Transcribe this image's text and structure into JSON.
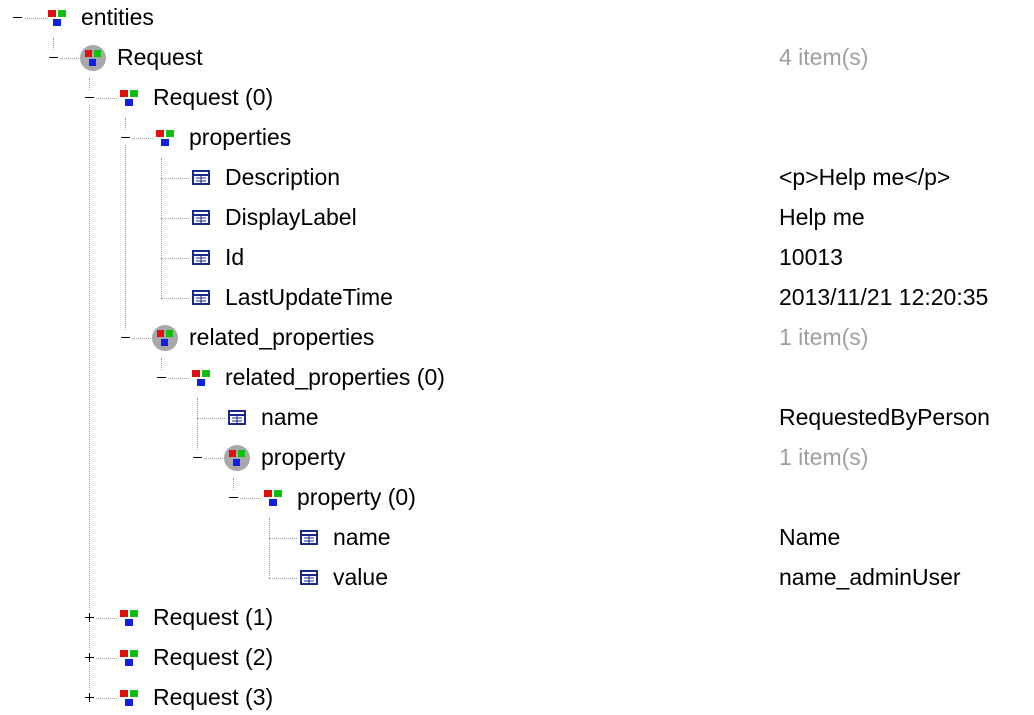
{
  "tree": {
    "nodes": [
      {
        "label": "entities",
        "value": "",
        "icon": "entity-group-icon"
      },
      {
        "label": "Request",
        "value": "4 item(s)",
        "icon": "collection-icon"
      },
      {
        "label": "Request (0)",
        "value": "",
        "icon": "entity-group-icon"
      },
      {
        "label": "properties",
        "value": "",
        "icon": "entity-group-icon"
      },
      {
        "label": "Description",
        "value": "<p>Help me</p>",
        "icon": "property-icon"
      },
      {
        "label": "DisplayLabel",
        "value": "Help me",
        "icon": "property-icon"
      },
      {
        "label": "Id",
        "value": "10013",
        "icon": "property-icon"
      },
      {
        "label": "LastUpdateTime",
        "value": "2013/11/21 12:20:35",
        "icon": "property-icon"
      },
      {
        "label": "related_properties",
        "value": "1 item(s)",
        "icon": "collection-icon"
      },
      {
        "label": "related_properties (0)",
        "value": "",
        "icon": "entity-group-icon"
      },
      {
        "label": "name",
        "value": "RequestedByPerson",
        "icon": "property-icon"
      },
      {
        "label": "property",
        "value": "1 item(s)",
        "icon": "collection-icon"
      },
      {
        "label": "property (0)",
        "value": "",
        "icon": "entity-group-icon"
      },
      {
        "label": "name",
        "value": "Name",
        "icon": "property-icon"
      },
      {
        "label": "value",
        "value": "name_adminUser",
        "icon": "property-icon"
      },
      {
        "label": "Request (1)",
        "value": "",
        "icon": "entity-group-icon"
      },
      {
        "label": "Request (2)",
        "value": "",
        "icon": "entity-group-icon"
      },
      {
        "label": "Request (3)",
        "value": "",
        "icon": "entity-group-icon"
      }
    ]
  },
  "colors": {
    "muted_text": "#a0a0a0",
    "node_red": "#e01010",
    "node_green": "#10c010",
    "node_blue": "#1020e0",
    "collection_circle": "#a8a8a8",
    "property_icon": "#1a2a8a"
  }
}
